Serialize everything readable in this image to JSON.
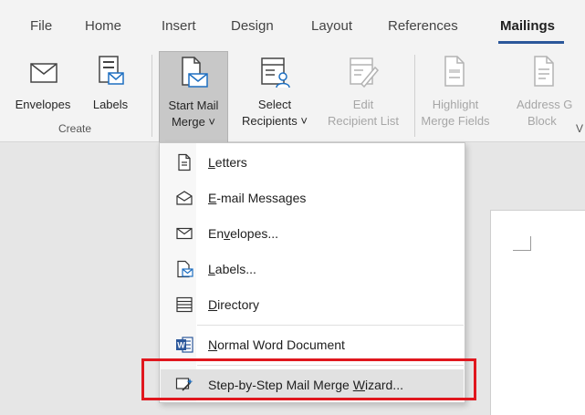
{
  "tabs": [
    {
      "label": "File",
      "active": false
    },
    {
      "label": "Home",
      "active": false
    },
    {
      "label": "Insert",
      "active": false
    },
    {
      "label": "Design",
      "active": false
    },
    {
      "label": "Layout",
      "active": false
    },
    {
      "label": "References",
      "active": false
    },
    {
      "label": "Mailings",
      "active": true
    }
  ],
  "ribbon": {
    "envelopes": {
      "label": "Envelopes",
      "icon": "envelope-icon"
    },
    "labels": {
      "label": "Labels",
      "icon": "labels-icon"
    },
    "start_mail_merge": {
      "line1": "Start Mail",
      "line2": "Merge ˅",
      "icon": "start-mail-merge-icon",
      "pressed": true
    },
    "select_recipients": {
      "line1": "Select",
      "line2": "Recipients ˅",
      "icon": "select-recipients-icon"
    },
    "edit_recipient_list": {
      "line1": "Edit",
      "line2": "Recipient List",
      "icon": "edit-list-icon",
      "disabled": true
    },
    "highlight_merge_fields": {
      "line1": "Highlight",
      "line2": "Merge Fields",
      "icon": "highlight-fields-icon",
      "disabled": true
    },
    "address_block": {
      "line1": "Address G",
      "line2": "Block",
      "icon": "address-block-icon",
      "disabled": true
    },
    "group_create": "Create",
    "group_partial": "V"
  },
  "menu": {
    "items": [
      {
        "pre": "",
        "u": "L",
        "post": "etters",
        "icon": "letter-document-icon"
      },
      {
        "pre": "",
        "u": "E",
        "post": "-mail Messages",
        "icon": "email-message-icon"
      },
      {
        "pre": "En",
        "u": "v",
        "post": "elopes...",
        "icon": "envelope-icon"
      },
      {
        "pre": "",
        "u": "L",
        "post": "abels...",
        "icon": "labels-icon"
      },
      {
        "pre": "",
        "u": "D",
        "post": "irectory",
        "icon": "directory-icon"
      },
      {
        "pre": "",
        "u": "N",
        "post": "ormal Word Document",
        "icon": "word-document-icon"
      },
      {
        "pre": "Step-by-Step Mail Merge ",
        "u": "W",
        "post": "izard...",
        "icon": "wizard-icon",
        "highlighted": true
      }
    ]
  },
  "colors": {
    "accent": "#2b579a",
    "highlight_box": "#e0171e",
    "word_icon": "#2b579a"
  }
}
